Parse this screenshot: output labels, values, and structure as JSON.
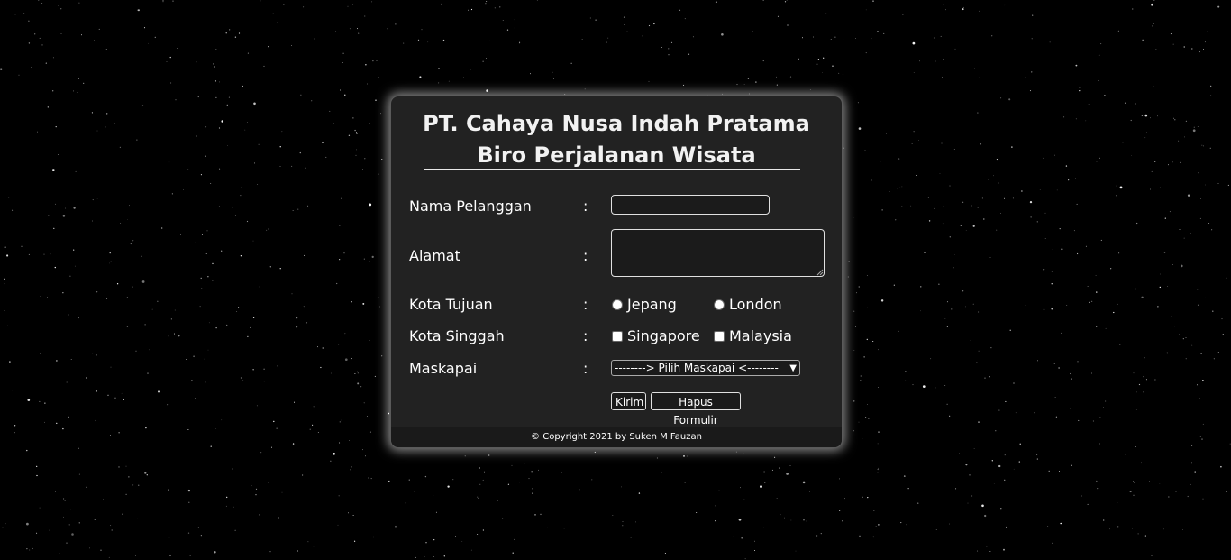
{
  "header": {
    "title_line1": "PT. Cahaya Nusa Indah Pratama",
    "title_line2": "Biro Perjalanan Wisata"
  },
  "form": {
    "separator": ":",
    "nama_pelanggan": {
      "label": "Nama Pelanggan",
      "value": ""
    },
    "alamat": {
      "label": "Alamat",
      "value": ""
    },
    "kota_tujuan": {
      "label": "Kota Tujuan",
      "options": [
        "Jepang",
        "London"
      ],
      "selected": null
    },
    "kota_singgah": {
      "label": "Kota Singgah",
      "options": [
        "Singapore",
        "Malaysia"
      ],
      "checked": []
    },
    "maskapai": {
      "label": "Maskapai",
      "selected": "--------> Pilih Maskapai <--------"
    },
    "submit_label": "Kirim",
    "reset_label": "Hapus Formulir"
  },
  "footer": {
    "copyright": "© Copyright 2021 by Suken M Fauzan"
  },
  "colors": {
    "page_background": "#000000",
    "card_background": "#222222",
    "text": "#ffffff"
  }
}
